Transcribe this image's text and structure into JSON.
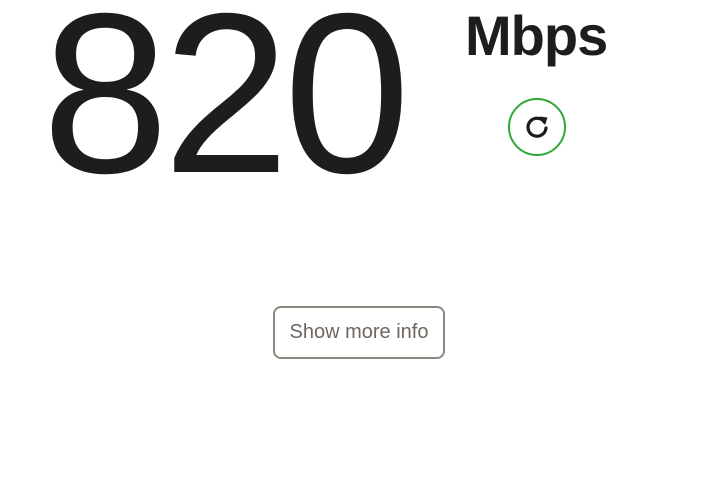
{
  "speed": {
    "value": "820",
    "units": "Mbps"
  },
  "refresh": {
    "icon": "refresh-icon",
    "accent_color": "#2ea836"
  },
  "more_info": {
    "label": "Show more info"
  }
}
